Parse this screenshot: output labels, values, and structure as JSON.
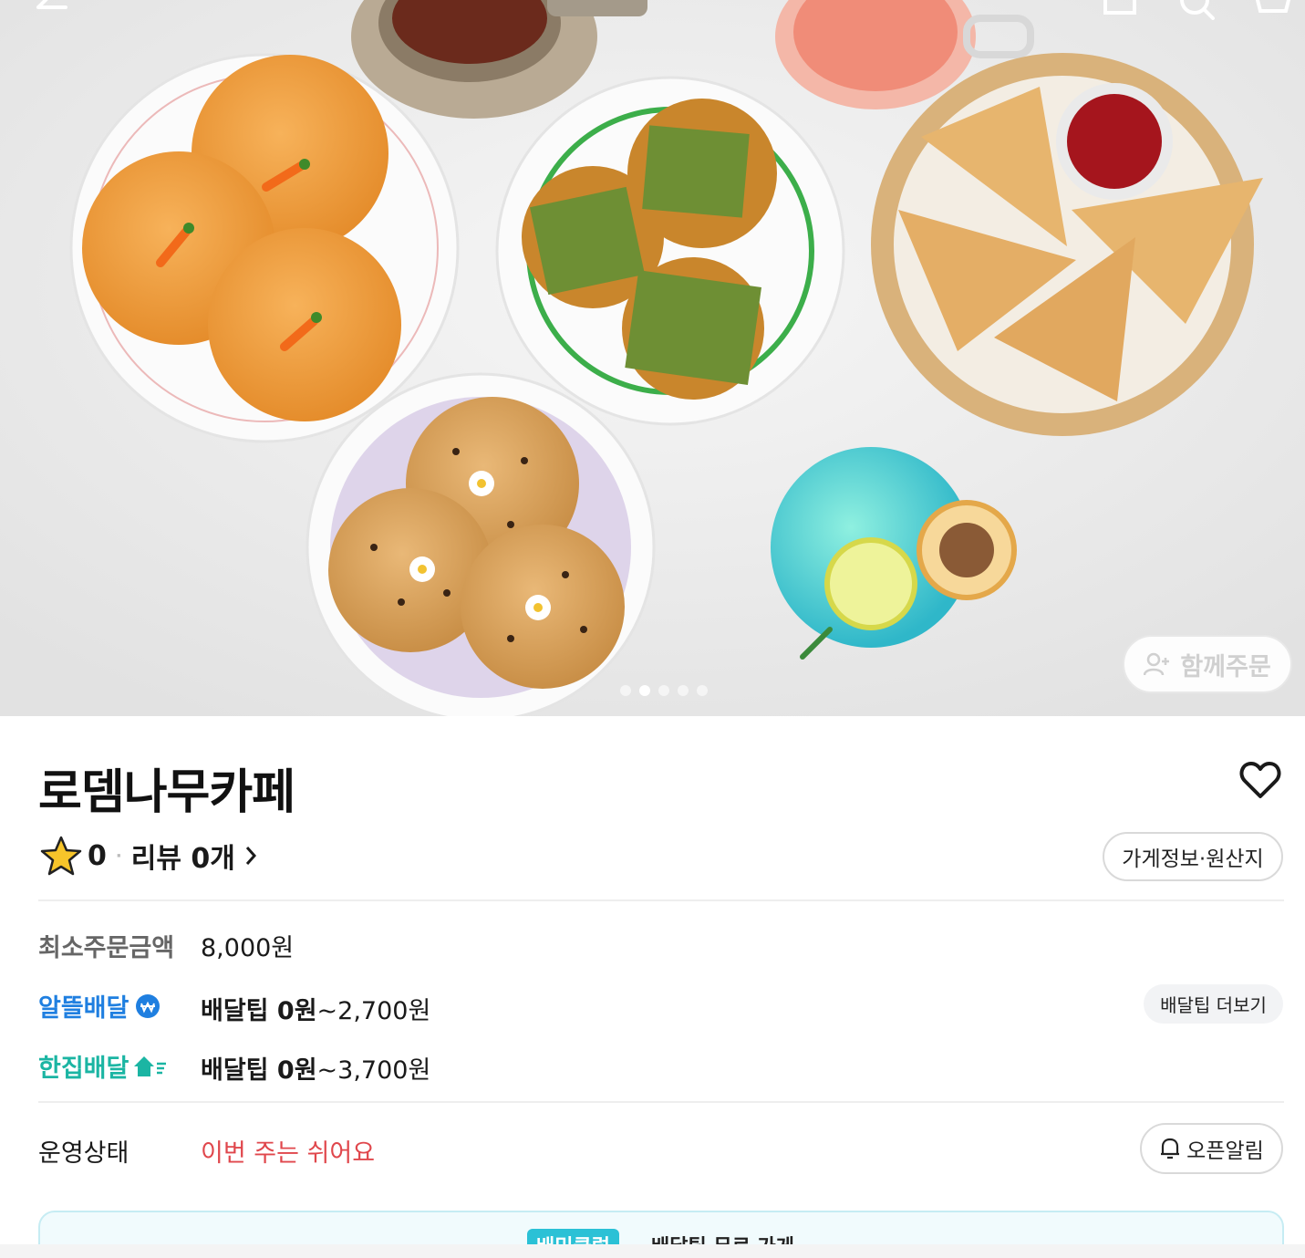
{
  "hero": {
    "group_order_label": "함께주문",
    "page_indicator": {
      "count": 5,
      "active_index": 1
    }
  },
  "store": {
    "name": "로뎀나무카페",
    "rating": "0",
    "review_label": "리뷰 0개",
    "info_button": "가게정보·원산지"
  },
  "order_info": {
    "min_order_label": "최소주문금액",
    "min_order_value": "8,000원",
    "saving_delivery_label": "알뜰배달",
    "saving_delivery_tip_bold": "배달팁 0원",
    "saving_delivery_tip_rest": "~2,700원",
    "tip_more_button": "배달팁 더보기",
    "single_delivery_label": "한집배달",
    "single_delivery_tip_bold": "배달팁 0원",
    "single_delivery_tip_rest": "~3,700원"
  },
  "operation": {
    "label": "운영상태",
    "status": "이번 주는 쉬어요",
    "alarm_button": "오픈알림"
  },
  "club_banner": {
    "badge": "배민클럽",
    "text": "배달팁 무료 가게"
  },
  "colors": {
    "accent_blue": "#1f7fe0",
    "accent_teal": "#1bb5a3",
    "status_red": "#e0474c",
    "club_cyan": "#2bc1d6"
  }
}
